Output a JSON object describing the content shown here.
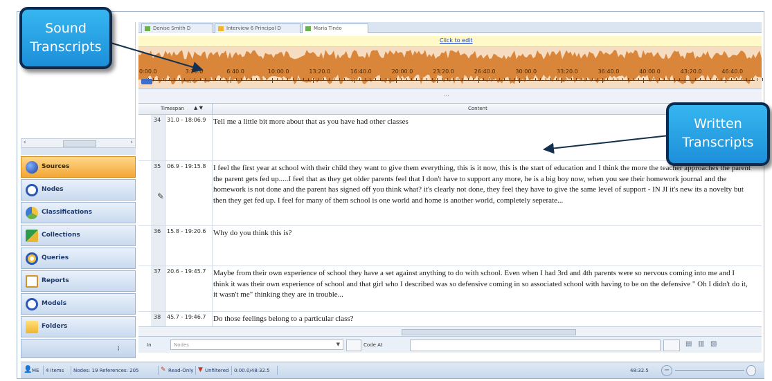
{
  "tabs": [
    {
      "label": "Denise Smith D",
      "icon": "transcript-icon",
      "active": false
    },
    {
      "label": "Interview 6 Principal D",
      "icon": "folder-icon",
      "active": false
    },
    {
      "label": "Maria Tinéo",
      "icon": "transcript-icon",
      "active": true
    }
  ],
  "media": {
    "edit_link": "Click to edit",
    "timeline_ticks": [
      "0:00.0",
      "3:20.0",
      "6:40.0",
      "10:00.0",
      "13:20.0",
      "16:40.0",
      "20:00.0",
      "23:20.0",
      "26:40.0",
      "30:00.0",
      "33:20.0",
      "36:40.0",
      "40:00.0",
      "43:20.0",
      "46:40.0"
    ],
    "waveform_color": "#d9863a"
  },
  "table": {
    "col_timespan": "Timespan",
    "col_content": "Content",
    "rows": [
      {
        "num": "34",
        "timespan": "31.0 - 18:06.9",
        "content": "Tell me a little bit more about that as you have had other classes"
      },
      {
        "num": "35",
        "timespan": "06.9 - 19:15.8",
        "content": "I feel the first year at school with their child they want to give them everything, this is it now, this is the start of education and I think the more the teacher approaches the parent the parent gets fed up.....I feel that as they get older parents feel that I don't have to support any more, he is a big boy now, when you see their homework journal and the homework is not done and the parent has signed off you think what? it's clearly not done, they feel they have to give the same level of support - IN JI it's new its a novelty but then they get fed up. I feel for many of them school is one world and home is another world, completely seperate..."
      },
      {
        "num": "36",
        "timespan": "15.8 - 19:20.6",
        "content": "Why do you think this is?"
      },
      {
        "num": "37",
        "timespan": "20.6 - 19:45.7",
        "content": "Maybe from their own experience of school they have a set against anything to do with school.  Even when I had 3rd and 4th parents were so nervous coming into me and I think it was their own experience of school and that girl who I described was so defensive coming in so associated school with having to be on the defensive \" Oh I didn't do it, it wasn't me\" thinking they are in trouble..."
      },
      {
        "num": "38",
        "timespan": "45.7 - 19:46.7",
        "content": "Do those feelings belong to a particular class?"
      }
    ]
  },
  "nav": {
    "items": [
      {
        "label": "Sources",
        "icon": "sources-icon",
        "active": true
      },
      {
        "label": "Nodes",
        "icon": "nodes-icon",
        "active": false
      },
      {
        "label": "Classifications",
        "icon": "classifications-icon",
        "active": false
      },
      {
        "label": "Collections",
        "icon": "collections-icon",
        "active": false
      },
      {
        "label": "Queries",
        "icon": "queries-icon",
        "active": false
      },
      {
        "label": "Reports",
        "icon": "reports-icon",
        "active": false
      },
      {
        "label": "Models",
        "icon": "models-icon",
        "active": false
      },
      {
        "label": "Folders",
        "icon": "folders-icon",
        "active": false
      }
    ]
  },
  "code_bar": {
    "in_label": "In",
    "in_placeholder": "Nodes",
    "code_at_label": "Code At"
  },
  "status": {
    "user": "ME",
    "items": "4 Items",
    "nodes_refs": "Nodes: 19  References: 205",
    "read_only": "Read-Only",
    "unfiltered": "Unfiltered",
    "time": "0:00.0/48:32.5",
    "zoom_time": "48:32.5"
  },
  "callouts": {
    "sound": "Sound Transcripts",
    "written": "Written Transcripts"
  },
  "colors": {
    "callout": "#1d8fd9",
    "active_nav": "#f3a635",
    "link": "#1b3fc4"
  }
}
